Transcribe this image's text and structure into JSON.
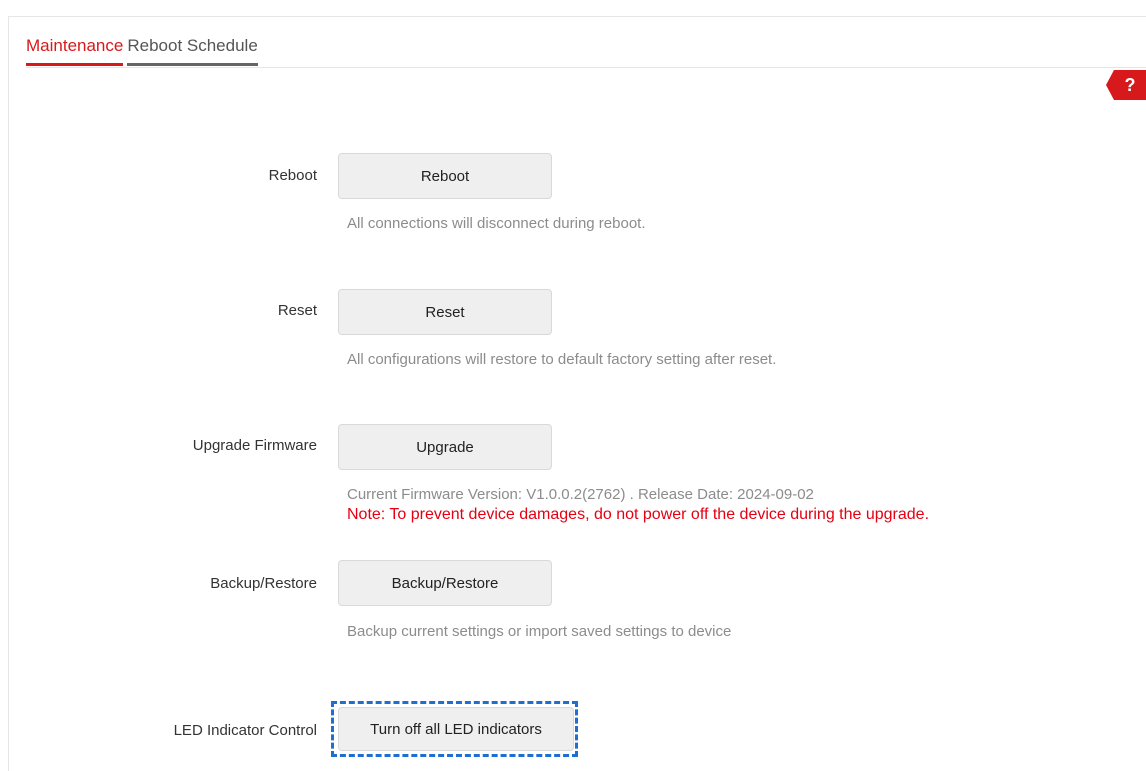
{
  "tabs": [
    {
      "label": "Maintenance",
      "active": true
    },
    {
      "label": "Reboot Schedule",
      "active": false
    }
  ],
  "help": {
    "icon": "question-icon",
    "symbol": "?",
    "color": "#d7191c"
  },
  "reboot": {
    "label": "Reboot",
    "button": "Reboot",
    "hint": "All connections will disconnect during reboot."
  },
  "reset": {
    "label": "Reset",
    "button": "Reset",
    "hint": "All configurations will restore to default factory setting after reset."
  },
  "upgrade": {
    "label": "Upgrade Firmware",
    "button": "Upgrade",
    "version_text": "Current Firmware Version: V1.0.0.2(2762) . Release Date: 2024-09-02",
    "note": "Note: To prevent device damages, do not power off the device during the upgrade."
  },
  "backup": {
    "label": "Backup/Restore",
    "button": "Backup/Restore",
    "hint": "Backup current settings or import saved settings to device"
  },
  "led": {
    "label": "LED Indicator Control",
    "button": "Turn off all LED indicators"
  },
  "colors": {
    "accent": "#d7191c",
    "note": "#e60012",
    "highlight": "#1f6fd1"
  }
}
